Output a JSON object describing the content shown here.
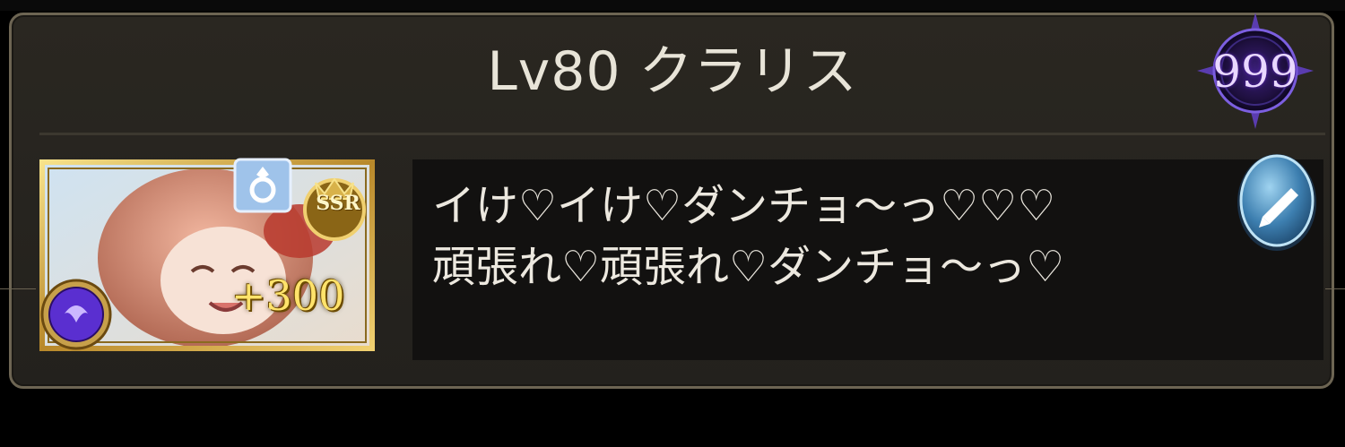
{
  "header": {
    "title": "Lv80 クラリス"
  },
  "badge": {
    "value": "999"
  },
  "card": {
    "rarity": "SSR",
    "plus": "+300",
    "element_icon": "dark-element-icon",
    "ring_icon": "ring-icon"
  },
  "comment": {
    "line1": "イけ♡イけ♡ダンチョ〜っ♡♡♡",
    "line2": "頑張れ♡頑張れ♡ダンチョ〜っ♡"
  },
  "edit_button": {
    "icon": "pencil-icon"
  },
  "colors": {
    "panel_border": "#6d6553",
    "panel_bg": "#26241f",
    "badge_purple": "#5b2bb0",
    "gold": "#ffe36b"
  }
}
